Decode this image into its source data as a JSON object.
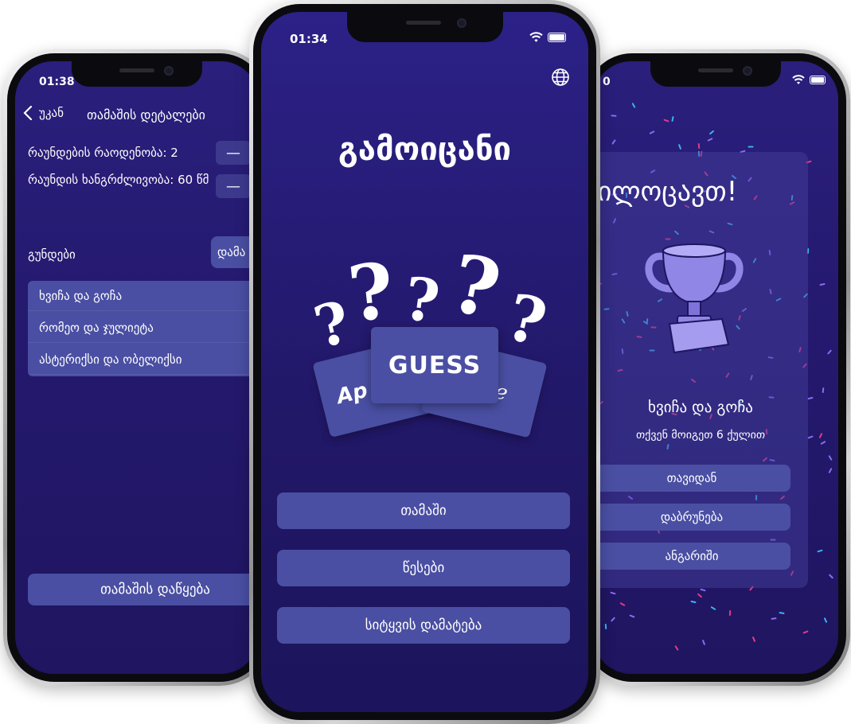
{
  "left_phone": {
    "time": "01:38",
    "back_label": "უკან",
    "title": "თამაშის დეტალები",
    "rounds_label": "რაუნდების რაოდენობა: 2",
    "duration_label": "რაუნდის ხანგრძლივობა: 60 წმ",
    "minus_symbol": "—",
    "teams_label": "გუნდები",
    "add_team_label": "დამა",
    "teams": [
      "ხვიჩა და გოჩა",
      "რომეო და ჯულიეტა",
      "ასტერიქსი და ობელიქსი"
    ],
    "start_button": "თამაშის დაწყება"
  },
  "center_phone": {
    "time": "01:34",
    "app_title": "გამოიცანი",
    "logo": {
      "card_text": "GUESS",
      "left_card": "Ap",
      "right_card": "ple"
    },
    "buttons": {
      "play": "თამაში",
      "rules": "წესები",
      "add_word": "სიტყვის დამატება"
    }
  },
  "right_phone": {
    "time": "0",
    "congrats": "გილოცავთ!",
    "winner": "ხვიჩა და გოჩა",
    "score_text": "თქვენ მოიგეთ 6 ქულით",
    "buttons": {
      "restart": "თავიდან",
      "back": "დაბრუნება",
      "score": "ანგარიში"
    }
  },
  "colors": {
    "background": "#24196e",
    "button": "#4a4fa3",
    "panel": "#3a3489",
    "trophy": "#8f86e6",
    "confetti": [
      "#e6398a",
      "#3ab4f2",
      "#8c6cf2"
    ]
  },
  "icons": [
    "back-chevron-icon",
    "globe-icon",
    "wifi-icon",
    "battery-icon",
    "trophy-icon"
  ]
}
